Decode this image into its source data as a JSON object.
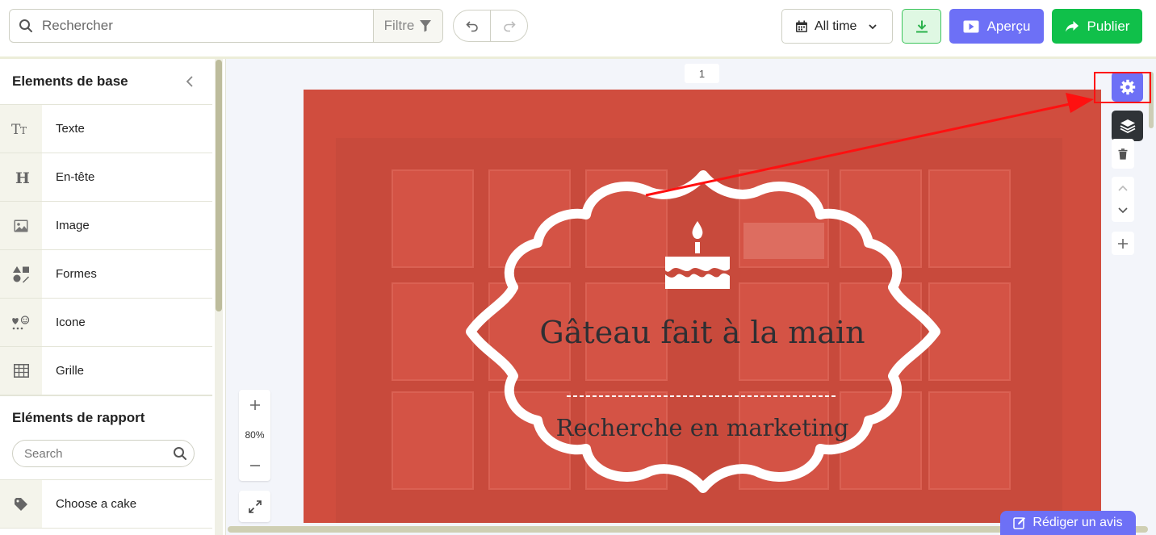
{
  "toolbar": {
    "search_placeholder": "Rechercher",
    "filter_label": "Filtre",
    "time_range": "All time",
    "preview_label": "Aperçu",
    "publish_label": "Publier"
  },
  "sidebar": {
    "basic_title": "Elements de base",
    "items": [
      {
        "label": "Texte",
        "icon": "text-size-icon"
      },
      {
        "label": "En-tête",
        "icon": "heading-icon"
      },
      {
        "label": "Image",
        "icon": "image-icon"
      },
      {
        "label": "Formes",
        "icon": "shapes-icon"
      },
      {
        "label": "Icone",
        "icon": "icons-icon"
      },
      {
        "label": "Grille",
        "icon": "grid-icon"
      }
    ],
    "report_title": "Eléments de rapport",
    "report_search_placeholder": "Search",
    "report_items": [
      {
        "label": "Choose a cake",
        "icon": "tag-icon"
      }
    ]
  },
  "canvas": {
    "page_number": "1",
    "zoom": "80%",
    "design_title": "Gâteau fait à la main",
    "design_subtitle": "Recherche en marketing"
  },
  "review_label": "Rédiger un avis",
  "colors": {
    "primary": "#6d70f6",
    "publish": "#10c04a",
    "download_bg": "#dff8e3",
    "design_overlay": "#d75244",
    "annotation": "#ff1010"
  }
}
